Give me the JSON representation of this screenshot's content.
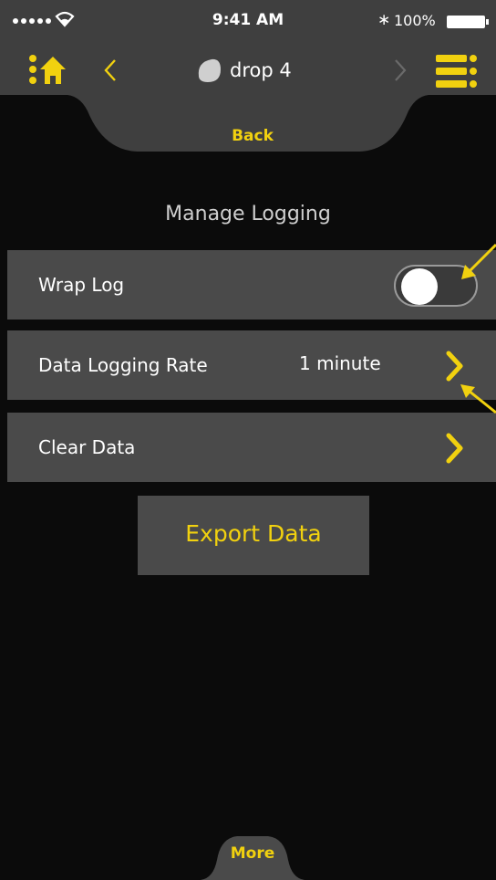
{
  "status_bar": {
    "time": "9:41 AM",
    "bluetooth_icon": "bluetooth-icon",
    "battery_percent": "100%"
  },
  "nav": {
    "device_name": "drop 4",
    "back_label": "Back",
    "home_icon": "home-icon",
    "menu_icon": "menu-icon"
  },
  "page": {
    "title": "Manage Logging"
  },
  "rows": [
    {
      "label": "Wrap Log",
      "toggle_on": false
    },
    {
      "label": "Data Logging Rate",
      "value": "1 minute"
    },
    {
      "label": "Clear Data"
    }
  ],
  "export": {
    "label": "Export Data"
  },
  "footer": {
    "more_label": "More"
  },
  "colors": {
    "accent": "#f1d10f",
    "row_bg": "#4a4a4a",
    "background": "#0b0b0b",
    "bar_bg": "#3f3f3f"
  }
}
